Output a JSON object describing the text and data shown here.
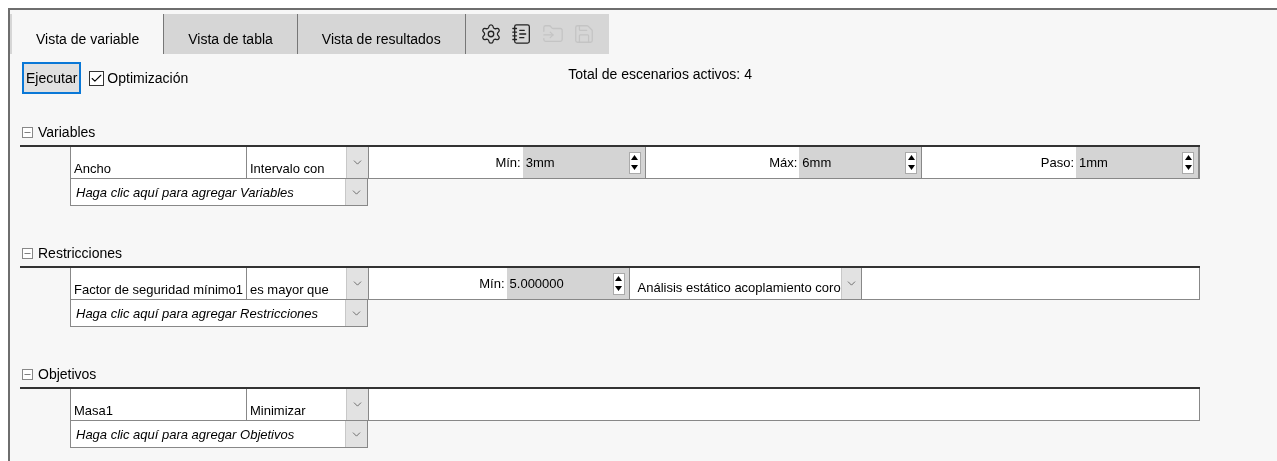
{
  "tabs": [
    {
      "label": "Vista de variable",
      "selected": true
    },
    {
      "label": "Vista de tabla",
      "selected": false
    },
    {
      "label": "Vista de resultados",
      "selected": false
    }
  ],
  "tools": [
    {
      "kind": "settings",
      "disabled": false
    },
    {
      "kind": "notebook",
      "disabled": false
    },
    {
      "kind": "folder",
      "disabled": true
    },
    {
      "kind": "save",
      "disabled": true
    }
  ],
  "run_button": "Ejecutar",
  "optimization": {
    "label": "Optimización",
    "checked": true
  },
  "total_scenarios": "Total de escenarios activos: 4",
  "sections": [
    {
      "title": "Variables",
      "expanded": true,
      "rows": [
        {
          "name": "Ancho",
          "mode": "Intervalo con",
          "fields": [
            {
              "kind": "spin",
              "label": "Mín:",
              "value": "3mm"
            },
            {
              "kind": "spin",
              "label": "Máx:",
              "value": "6mm"
            },
            {
              "kind": "spin",
              "label": "Paso:",
              "value": "1mm"
            }
          ]
        }
      ],
      "add_prompt": "Haga clic aquí para agregar Variables"
    },
    {
      "title": "Restricciones",
      "expanded": true,
      "rows": [
        {
          "name": "Factor de seguridad mínimo1",
          "mode": "es mayor que",
          "fields": [
            {
              "kind": "spin",
              "label": "Mín:",
              "value": "5.000000"
            },
            {
              "kind": "combo",
              "value": "Análisis estático acoplamiento coro"
            }
          ]
        }
      ],
      "add_prompt": "Haga clic aquí para agregar Restricciones"
    },
    {
      "title": "Objetivos",
      "expanded": true,
      "rows": [
        {
          "name": "Masa1",
          "mode": "Minimizar",
          "fields": []
        }
      ],
      "add_prompt": "Haga clic aquí para agregar Objetivos"
    }
  ]
}
